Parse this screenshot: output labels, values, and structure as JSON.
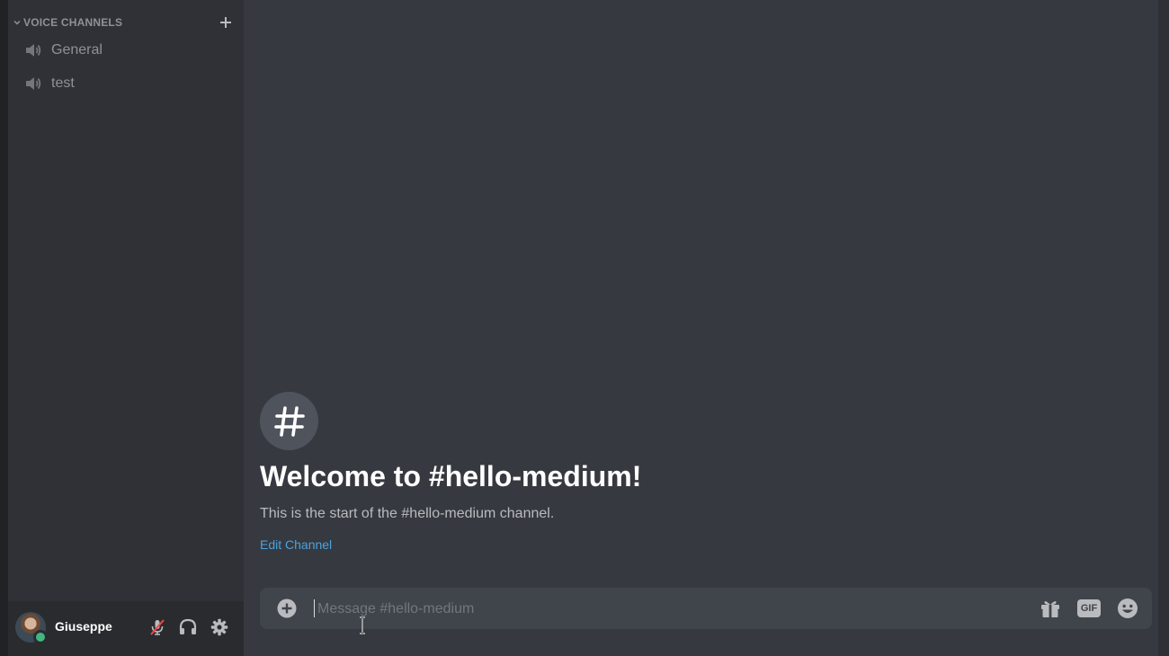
{
  "sidebar": {
    "category_label": "VOICE CHANNELS",
    "voice_channels": [
      {
        "label": "General",
        "icon": "speaker-icon"
      },
      {
        "label": "test",
        "icon": "speaker-icon"
      }
    ]
  },
  "user": {
    "name": "Giuseppe",
    "status": "online",
    "status_color": "#43b581",
    "controls": [
      "mic-muted-icon",
      "headphones-icon",
      "gear-icon"
    ]
  },
  "channel": {
    "symbol": "#",
    "welcome_title": "Welcome to #hello-medium!",
    "start_text": "This is the start of the #hello-medium channel.",
    "edit_link": "Edit Channel"
  },
  "composer": {
    "placeholder": "Message #hello-medium",
    "value": "",
    "gif_label": "GIF"
  },
  "colors": {
    "sidebar_bg": "#2f3136",
    "main_bg": "#36393f",
    "composer_bg": "#40444b",
    "link": "#4aa3df"
  }
}
